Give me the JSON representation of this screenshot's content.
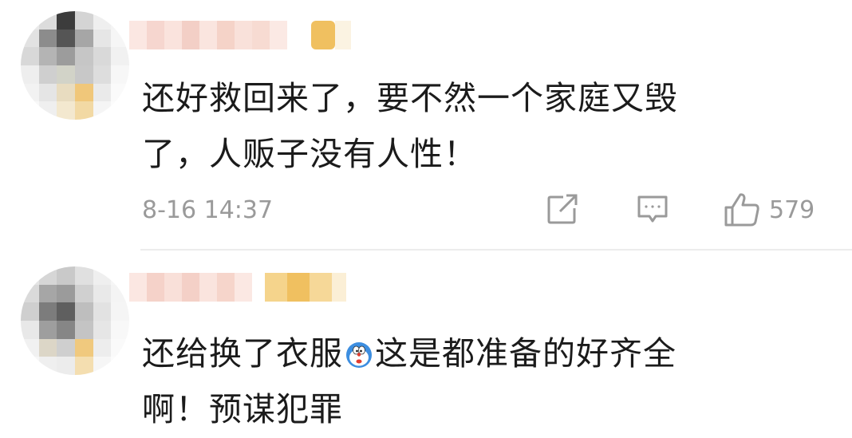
{
  "comments": [
    {
      "text_lines": [
        "还好救回来了，要不然一个家庭又毁",
        "了，人贩子没有人性！"
      ],
      "timestamp": "8-16 14:37",
      "like_count": "579"
    },
    {
      "text_line1_before_emoji": "还给换了衣服",
      "emoji": "doraemon-emoji",
      "text_line1_after_emoji": "这是都准备的好齐全",
      "text_line2": "啊！预谋犯罪"
    }
  ],
  "icons": {
    "share": "share-icon",
    "comment": "comment-icon",
    "like": "thumbs-up-icon"
  },
  "colors": {
    "text": "#1b1b1b",
    "meta": "#9a9a9a",
    "divider": "#ececec",
    "mosaic_gold": "#f0c060"
  }
}
